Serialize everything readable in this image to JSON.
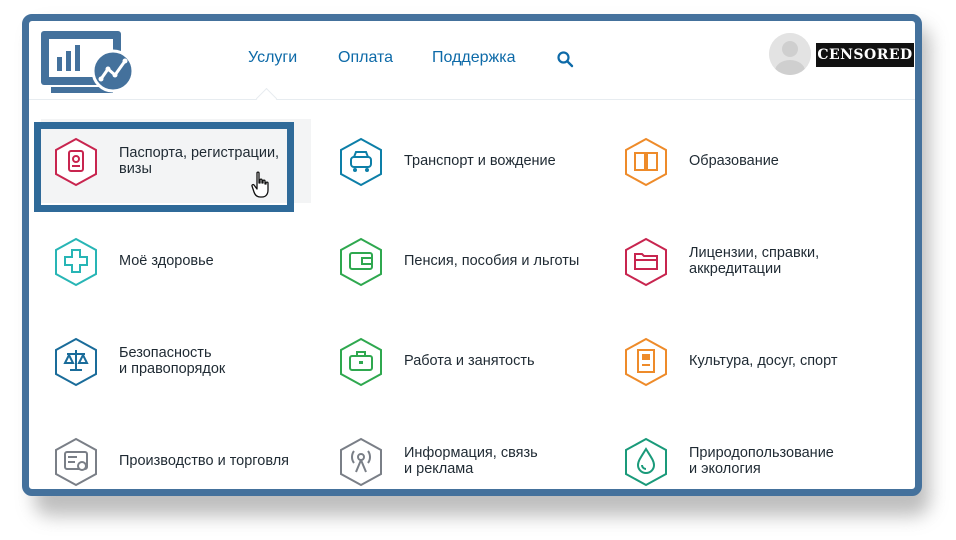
{
  "header": {
    "nav": [
      {
        "label": "Услуги"
      },
      {
        "label": "Оплата"
      },
      {
        "label": "Поддержка"
      }
    ],
    "search_icon": "search-icon",
    "censored_text": "CENSORED"
  },
  "colors": {
    "frame": "#44719c",
    "nav_link": "#0d6aa8",
    "highlight": "#2f6a99"
  },
  "categories": [
    {
      "label": "Паспорта, регистрации,\nвизы",
      "icon": "passport-icon",
      "color": "#c8254f"
    },
    {
      "label": "Транспорт и вождение",
      "icon": "car-icon",
      "color": "#0d7fa8"
    },
    {
      "label": "Образование",
      "icon": "book-icon",
      "color": "#ee8b2a"
    },
    {
      "label": "Моё здоровье",
      "icon": "medical-cross-icon",
      "color": "#28b5b5"
    },
    {
      "label": "Пенсия, пособия и льготы",
      "icon": "wallet-icon",
      "color": "#2fa84f"
    },
    {
      "label": "Лицензии, справки,\nаккредитации",
      "icon": "folder-icon",
      "color": "#c8254f"
    },
    {
      "label": "Безопасность\nи правопорядок",
      "icon": "scales-icon",
      "color": "#1a6c9a"
    },
    {
      "label": "Работа и занятость",
      "icon": "briefcase-icon",
      "color": "#2fa84f"
    },
    {
      "label": "Культура, досуг, спорт",
      "icon": "theater-icon",
      "color": "#ee8b2a"
    },
    {
      "label": "Производство и торговля",
      "icon": "certificate-icon",
      "color": "#7a7f87"
    },
    {
      "label": "Информация, связь\nи реклама",
      "icon": "antenna-icon",
      "color": "#7a7f87"
    },
    {
      "label": "Природопользование\nи экология",
      "icon": "water-drop-icon",
      "color": "#1a9a7a"
    }
  ]
}
